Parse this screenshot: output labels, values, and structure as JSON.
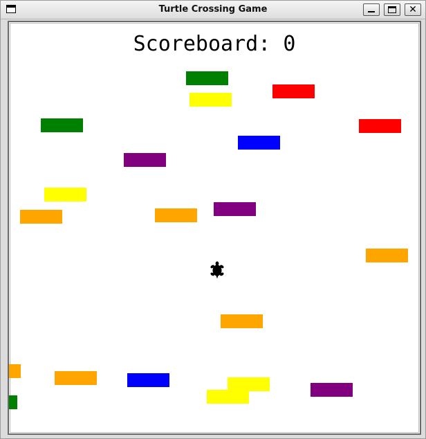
{
  "window": {
    "title": "Turtle Crossing Game",
    "controls": {
      "minimize": "_",
      "maximize": "□",
      "close": "✕"
    }
  },
  "game": {
    "scoreboard_label": "Scoreboard: 0",
    "score": 0,
    "player": {
      "icon": "turtle-icon",
      "color": "#000000"
    },
    "cars": [
      {
        "color": "green"
      },
      {
        "color": "yellow"
      },
      {
        "color": "red"
      },
      {
        "color": "green"
      },
      {
        "color": "red"
      },
      {
        "color": "blue"
      },
      {
        "color": "purple"
      },
      {
        "color": "yellow"
      },
      {
        "color": "orange"
      },
      {
        "color": "orange"
      },
      {
        "color": "purple"
      },
      {
        "color": "orange"
      },
      {
        "color": "orange"
      },
      {
        "color": "orange"
      },
      {
        "color": "orange"
      },
      {
        "color": "blue"
      },
      {
        "color": "yellow"
      },
      {
        "color": "yellow"
      },
      {
        "color": "purple"
      },
      {
        "color": "green"
      }
    ]
  },
  "colors": {
    "green": "#008000",
    "yellow": "#ffff00",
    "red": "#ff0000",
    "blue": "#0000ff",
    "purple": "#800080",
    "orange": "#ffa500"
  }
}
